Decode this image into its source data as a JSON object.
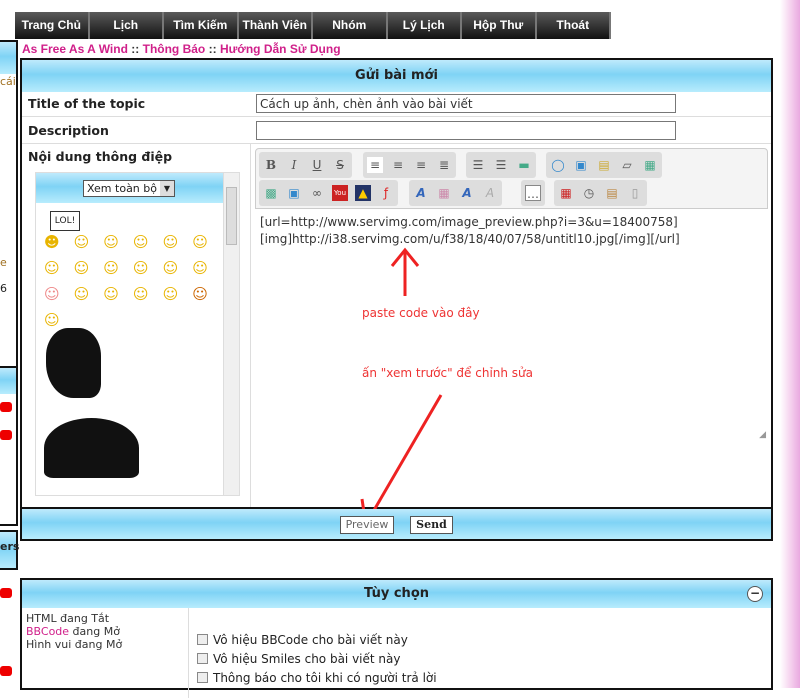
{
  "nav": [
    "Trang Chủ",
    "Lịch",
    "Tìm Kiếm",
    "Thành Viên",
    "Nhóm",
    "Lý Lịch",
    "Hộp Thư",
    "Thoát"
  ],
  "breadcrumb": {
    "items": [
      "As Free As A Wind",
      "Thông Báo",
      "Hướng Dẫn Sử Dụng"
    ],
    "sep": "::"
  },
  "sidebar_fragments": [
    "cái",
    "e",
    "6",
    "ers"
  ],
  "form": {
    "title": "Gửi bài mới",
    "title_label": "Title of the topic",
    "title_value": "Cách up ảnh, chèn ảnh vào bài viết",
    "desc_label": "Description",
    "desc_value": "",
    "content_label": "Nội dung thông điệp",
    "smilies_select": "Xem toàn bộ",
    "smilie_sign": "LOL!",
    "toolbar": {
      "row1": [
        "bold",
        "italic",
        "underline",
        "strike",
        "align-left",
        "align-center",
        "align-right",
        "justify",
        "bullet-list",
        "numbered-list",
        "horizontal-rule",
        "quote",
        "code",
        "spoiler",
        "hide",
        "table"
      ],
      "row2": [
        "image",
        "image-upload",
        "link",
        "youtube",
        "flash",
        "flash-red",
        "font-size",
        "color",
        "font",
        "remove-format",
        "more",
        "date",
        "clock",
        "paste",
        "page"
      ]
    },
    "text_lines": [
      "[url=http://www.servimg.com/image_preview.php?i=3&u=18400758]",
      "[img]http://i38.servimg.com/u/f38/18/40/07/58/untitl10.jpg[/img][/url]"
    ],
    "annotation1": "paste code vào đây",
    "annotation2": "ấn \"xem trước\" để chỉnh sửa",
    "preview": "Preview",
    "send": "Send"
  },
  "options": {
    "title": "Tùy chọn",
    "status": [
      {
        "k": "HTML",
        "v": " đang Tắt"
      },
      {
        "k": "BBCode",
        "v": " đang Mở"
      },
      {
        "k": "Hình vui",
        "v": " đang Mở"
      }
    ],
    "checks": [
      "Vô hiệu BBCode cho bài viết này",
      "Vô hiệu Smiles cho bài viết này",
      "Thông báo cho tôi khi có người trả lời"
    ]
  },
  "colors": {
    "accent": "#d0208a",
    "annotation": "#e33333",
    "header": "#7fd3f5"
  }
}
